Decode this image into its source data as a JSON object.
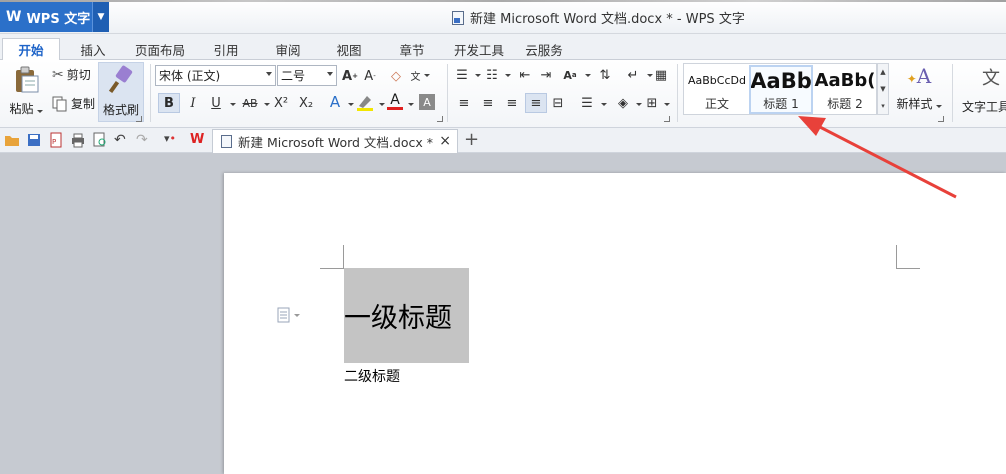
{
  "app": {
    "name": "WPS 文字",
    "dropdown_icon": "chevron-down-icon"
  },
  "window": {
    "title": "新建 Microsoft Word 文档.docx * - WPS 文字"
  },
  "menu_tabs": [
    "开始",
    "插入",
    "页面布局",
    "引用",
    "审阅",
    "视图",
    "章节",
    "开发工具",
    "云服务"
  ],
  "active_tab": "开始",
  "ribbon": {
    "paste_label": "粘贴",
    "cut_label": "剪切",
    "copy_label": "复制",
    "format_painter_label": "格式刷",
    "font_name": "宋体 (正文)",
    "font_size": "二号",
    "bold": "B",
    "italic": "I",
    "underline": "U",
    "strike": "AB",
    "superscript": "X²",
    "subscript": "X₂",
    "font_color_letter": "A",
    "styles": [
      {
        "sample": "AaBbCcDd",
        "label": "正文"
      },
      {
        "sample": "AaBb",
        "label": "标题 1"
      },
      {
        "sample": "AaBb(",
        "label": "标题 2"
      }
    ],
    "new_style_label": "新样式",
    "text_tools_label": "文字工具"
  },
  "document_tab": {
    "name": "新建 Microsoft Word 文档.docx *",
    "close": "×",
    "add": "+"
  },
  "document": {
    "heading1": "一级标题",
    "heading2": "二级标题"
  },
  "colors": {
    "accent": "#2b70c9",
    "active_tab_text": "#1e64c8",
    "heading_shading": "#c4c4c4",
    "annotation_arrow": "#e8413a"
  }
}
